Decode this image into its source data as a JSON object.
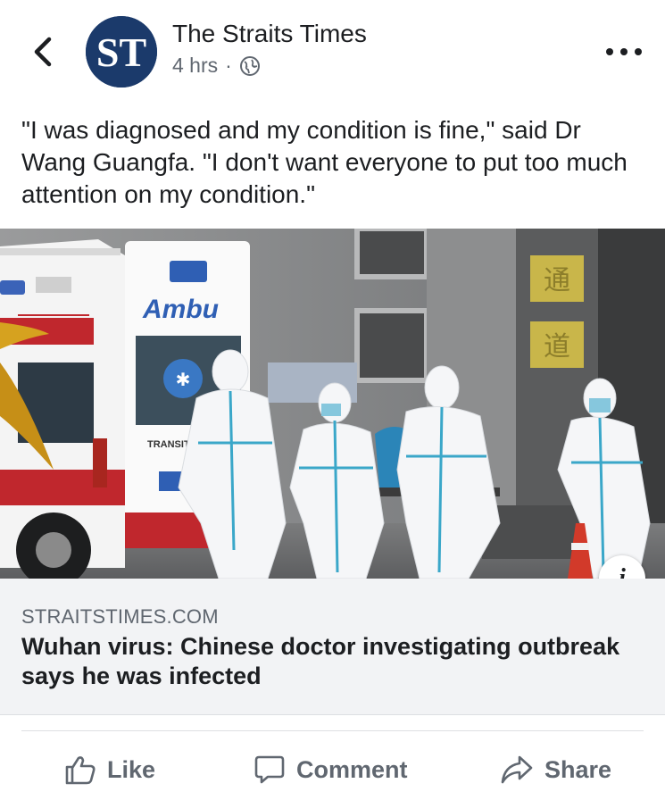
{
  "header": {
    "page_name": "The Straits Times",
    "avatar_text": "ST",
    "time": "4 hrs",
    "separator": "·",
    "back_icon": "chevron-left-icon",
    "privacy_icon": "globe-icon",
    "more_icon": "more-dots-icon"
  },
  "post": {
    "text": "\"I was diagnosed and my condition is fine,\" said Dr Wang Guangfa. \"I don't want everyone to put too much attention on my condition.\""
  },
  "photo": {
    "ambulance_text": "Ambu",
    "transit_text": "TRANSIT",
    "sign_chars": [
      "通",
      "道"
    ],
    "info_label": "i"
  },
  "link": {
    "domain": "STRAITSTIMES.COM",
    "headline": "Wuhan virus: Chinese doctor investigating outbreak says he was infected"
  },
  "actions": {
    "like_label": "Like",
    "comment_label": "Comment",
    "share_label": "Share"
  },
  "colors": {
    "brand_navy": "#1b3a6b",
    "text_primary": "#1c1e21",
    "text_secondary": "#606770",
    "link_bg": "#f2f3f5",
    "suit_tape": "#3aa7c9"
  }
}
